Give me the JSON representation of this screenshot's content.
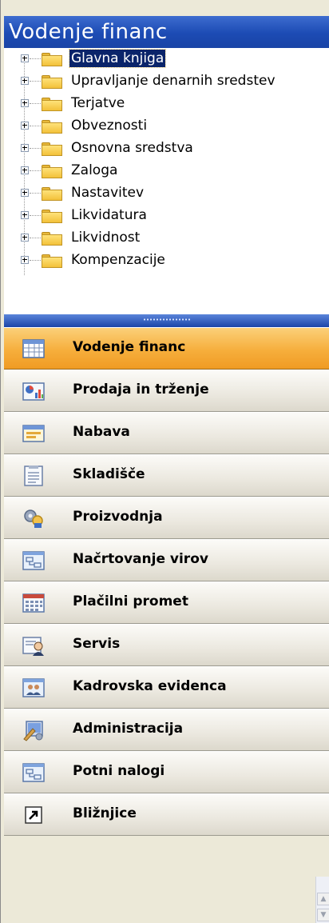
{
  "header": {
    "title": "Vodenje financ"
  },
  "tree": {
    "items": [
      {
        "label": "Glavna knjiga",
        "selected": true
      },
      {
        "label": "Upravljanje denarnih sredstev"
      },
      {
        "label": "Terjatve"
      },
      {
        "label": "Obveznosti"
      },
      {
        "label": "Osnovna sredstva"
      },
      {
        "label": "Zaloga"
      },
      {
        "label": "Nastavitev"
      },
      {
        "label": "Likvidatura"
      },
      {
        "label": "Likvidnost"
      },
      {
        "label": "Kompenzacije"
      }
    ]
  },
  "buttons": [
    {
      "label": "Vodenje financ",
      "icon": "ledger-grid-icon",
      "active": true
    },
    {
      "label": "Prodaja in trženje",
      "icon": "sales-chart-icon"
    },
    {
      "label": "Nabava",
      "icon": "purchase-form-icon"
    },
    {
      "label": "Skladišče",
      "icon": "warehouse-list-icon"
    },
    {
      "label": "Proizvodnja",
      "icon": "production-gear-icon"
    },
    {
      "label": "Načrtovanje virov",
      "icon": "resource-plan-icon"
    },
    {
      "label": "Plačilni promet",
      "icon": "payment-calculator-icon"
    },
    {
      "label": "Servis",
      "icon": "service-person-icon"
    },
    {
      "label": "Kadrovska evidenca",
      "icon": "hr-people-icon"
    },
    {
      "label": "Administracija",
      "icon": "administration-tools-icon"
    },
    {
      "label": "Potni nalogi",
      "icon": "travel-order-icon"
    },
    {
      "label": "Bližnjice",
      "icon": "shortcut-arrow-icon"
    }
  ],
  "colors": {
    "header": "#1c4bb4",
    "active": "#f6ae3c",
    "selection": "#0a246a"
  }
}
